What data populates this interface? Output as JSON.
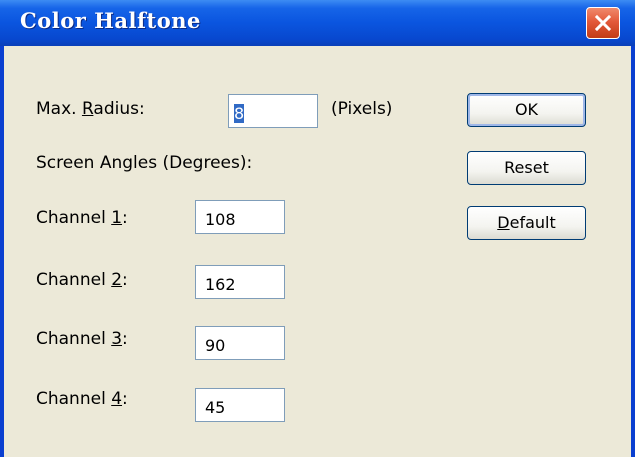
{
  "dialog": {
    "title": "Color Halftone",
    "max_radius": {
      "label_prefix": "Max. ",
      "label_accel": "R",
      "label_suffix": "adius:",
      "value": "8",
      "unit": "(Pixels)"
    },
    "screen_angles_label": "Screen Angles (Degrees):",
    "channels": [
      {
        "label_prefix": "Channel ",
        "label_accel": "1",
        "label_suffix": ":",
        "value": "108"
      },
      {
        "label_prefix": "Channel ",
        "label_accel": "2",
        "label_suffix": ":",
        "value": "162"
      },
      {
        "label_prefix": "Channel ",
        "label_accel": "3",
        "label_suffix": ":",
        "value": "90"
      },
      {
        "label_prefix": "Channel ",
        "label_accel": "4",
        "label_suffix": ":",
        "value": "45"
      }
    ],
    "buttons": {
      "ok": "OK",
      "reset": "Reset",
      "default_accel": "D",
      "default_rest": "efault"
    }
  },
  "colors": {
    "titlebar": "#0a55df",
    "close": "#e35a3a",
    "body": "#ece9d8"
  },
  "icons": {
    "close": "close-icon"
  }
}
